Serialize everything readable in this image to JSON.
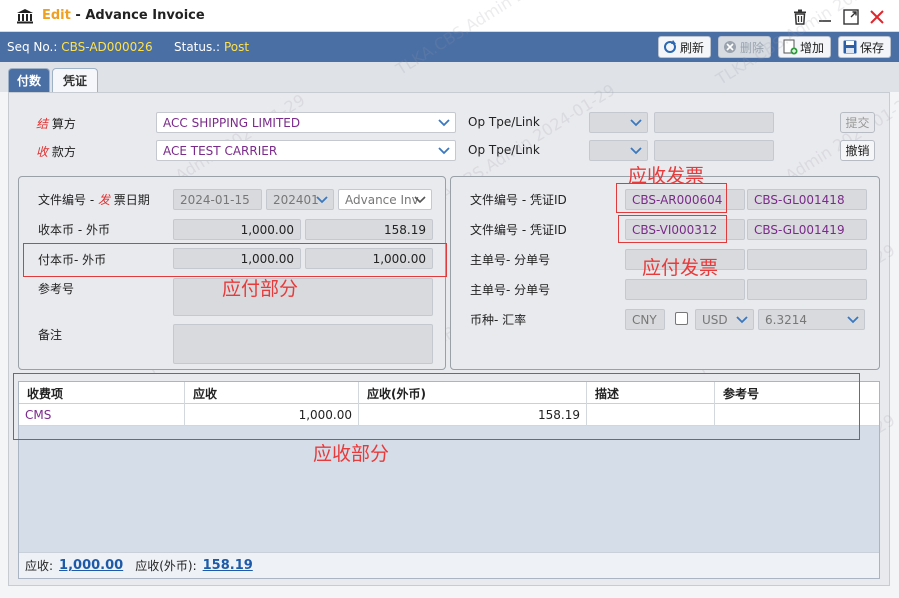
{
  "window": {
    "title_prefix": "Edit",
    "title_sep": " - ",
    "title": "Advance Invoice"
  },
  "toolbar": {
    "seq_label": "Seq No.:",
    "seq_value": "CBS-AD000026",
    "status_label": "Status.:",
    "status_value": "Post",
    "refresh_label": "刷新",
    "delete_label": "删除",
    "add_label": "增加",
    "save_label": "保存"
  },
  "tabs": [
    {
      "label": "付数"
    },
    {
      "label": "凭证"
    }
  ],
  "party": {
    "settle_label_red": "结",
    "settle_label_rest": " 算方",
    "settle_value": "ACC SHIPPING LIMITED",
    "receiver_label_red": "收",
    "receiver_label_rest": " 款方",
    "receiver_value": "ACE TEST CARRIER",
    "op_label_1": "Op Tpe/Link",
    "op_label_2": "Op Tpe/Link",
    "submit_label": "提交",
    "withdraw_label": "撤销"
  },
  "left_panel": {
    "docno_label_a": "文件编号 - ",
    "docno_label_red": "发",
    "docno_label_b": " 票日期",
    "date_value": "2024-01-15",
    "period_value": "202401",
    "type_value": "Advance Inv",
    "recv_label": "收本币 - 外币",
    "recv_local": "1,000.00",
    "recv_foreign": "158.19",
    "pay_label": "付本币- 外币",
    "pay_local": "1,000.00",
    "pay_foreign": "1,000.00",
    "ref_label": "参考号",
    "remark_label": "备注"
  },
  "right_panel": {
    "doc1_label": "文件编号 - 凭证ID",
    "doc1_no": "CBS-AR000604",
    "doc1_voucher": "CBS-GL001418",
    "doc2_label": "文件编号 - 凭证ID",
    "doc2_no": "CBS-VI000312",
    "doc2_voucher": "CBS-GL001419",
    "mbl_label_1": "主单号- 分单号",
    "mbl_label_2": "主单号- 分单号",
    "currency_label": "币种- 汇率",
    "currency_base": "CNY",
    "currency_foreign": "USD",
    "exchange_rate": "6.3214"
  },
  "annotations": {
    "ar_invoice": "应收发票",
    "ap_invoice": "应付发票",
    "payable_part": "应付部分",
    "receivable_part": "应收部分"
  },
  "grid": {
    "columns": [
      "收费项",
      "应收",
      "应收(外币)",
      "描述",
      "参考号"
    ],
    "rows": [
      {
        "item": "CMS",
        "recv": "1,000.00",
        "recv_foreign": "158.19",
        "desc": "",
        "ref": ""
      }
    ],
    "footer": {
      "recv_label": "应收:",
      "recv_total": "1,000.00",
      "recv_foreign_label": "应收(外币):",
      "recv_foreign_total": "158.19"
    }
  },
  "watermark": {
    "text": "TLKA.CBS.Admin 2024-01-29"
  },
  "colors": {
    "toolbar_bg": "#4a6fa5",
    "accent_yellow": "#ffe24a",
    "title_edit": "#f0a020",
    "annotation_red": "#e83a3a",
    "party_purple": "#7a2a8a",
    "link_blue": "#1d5aa8"
  }
}
